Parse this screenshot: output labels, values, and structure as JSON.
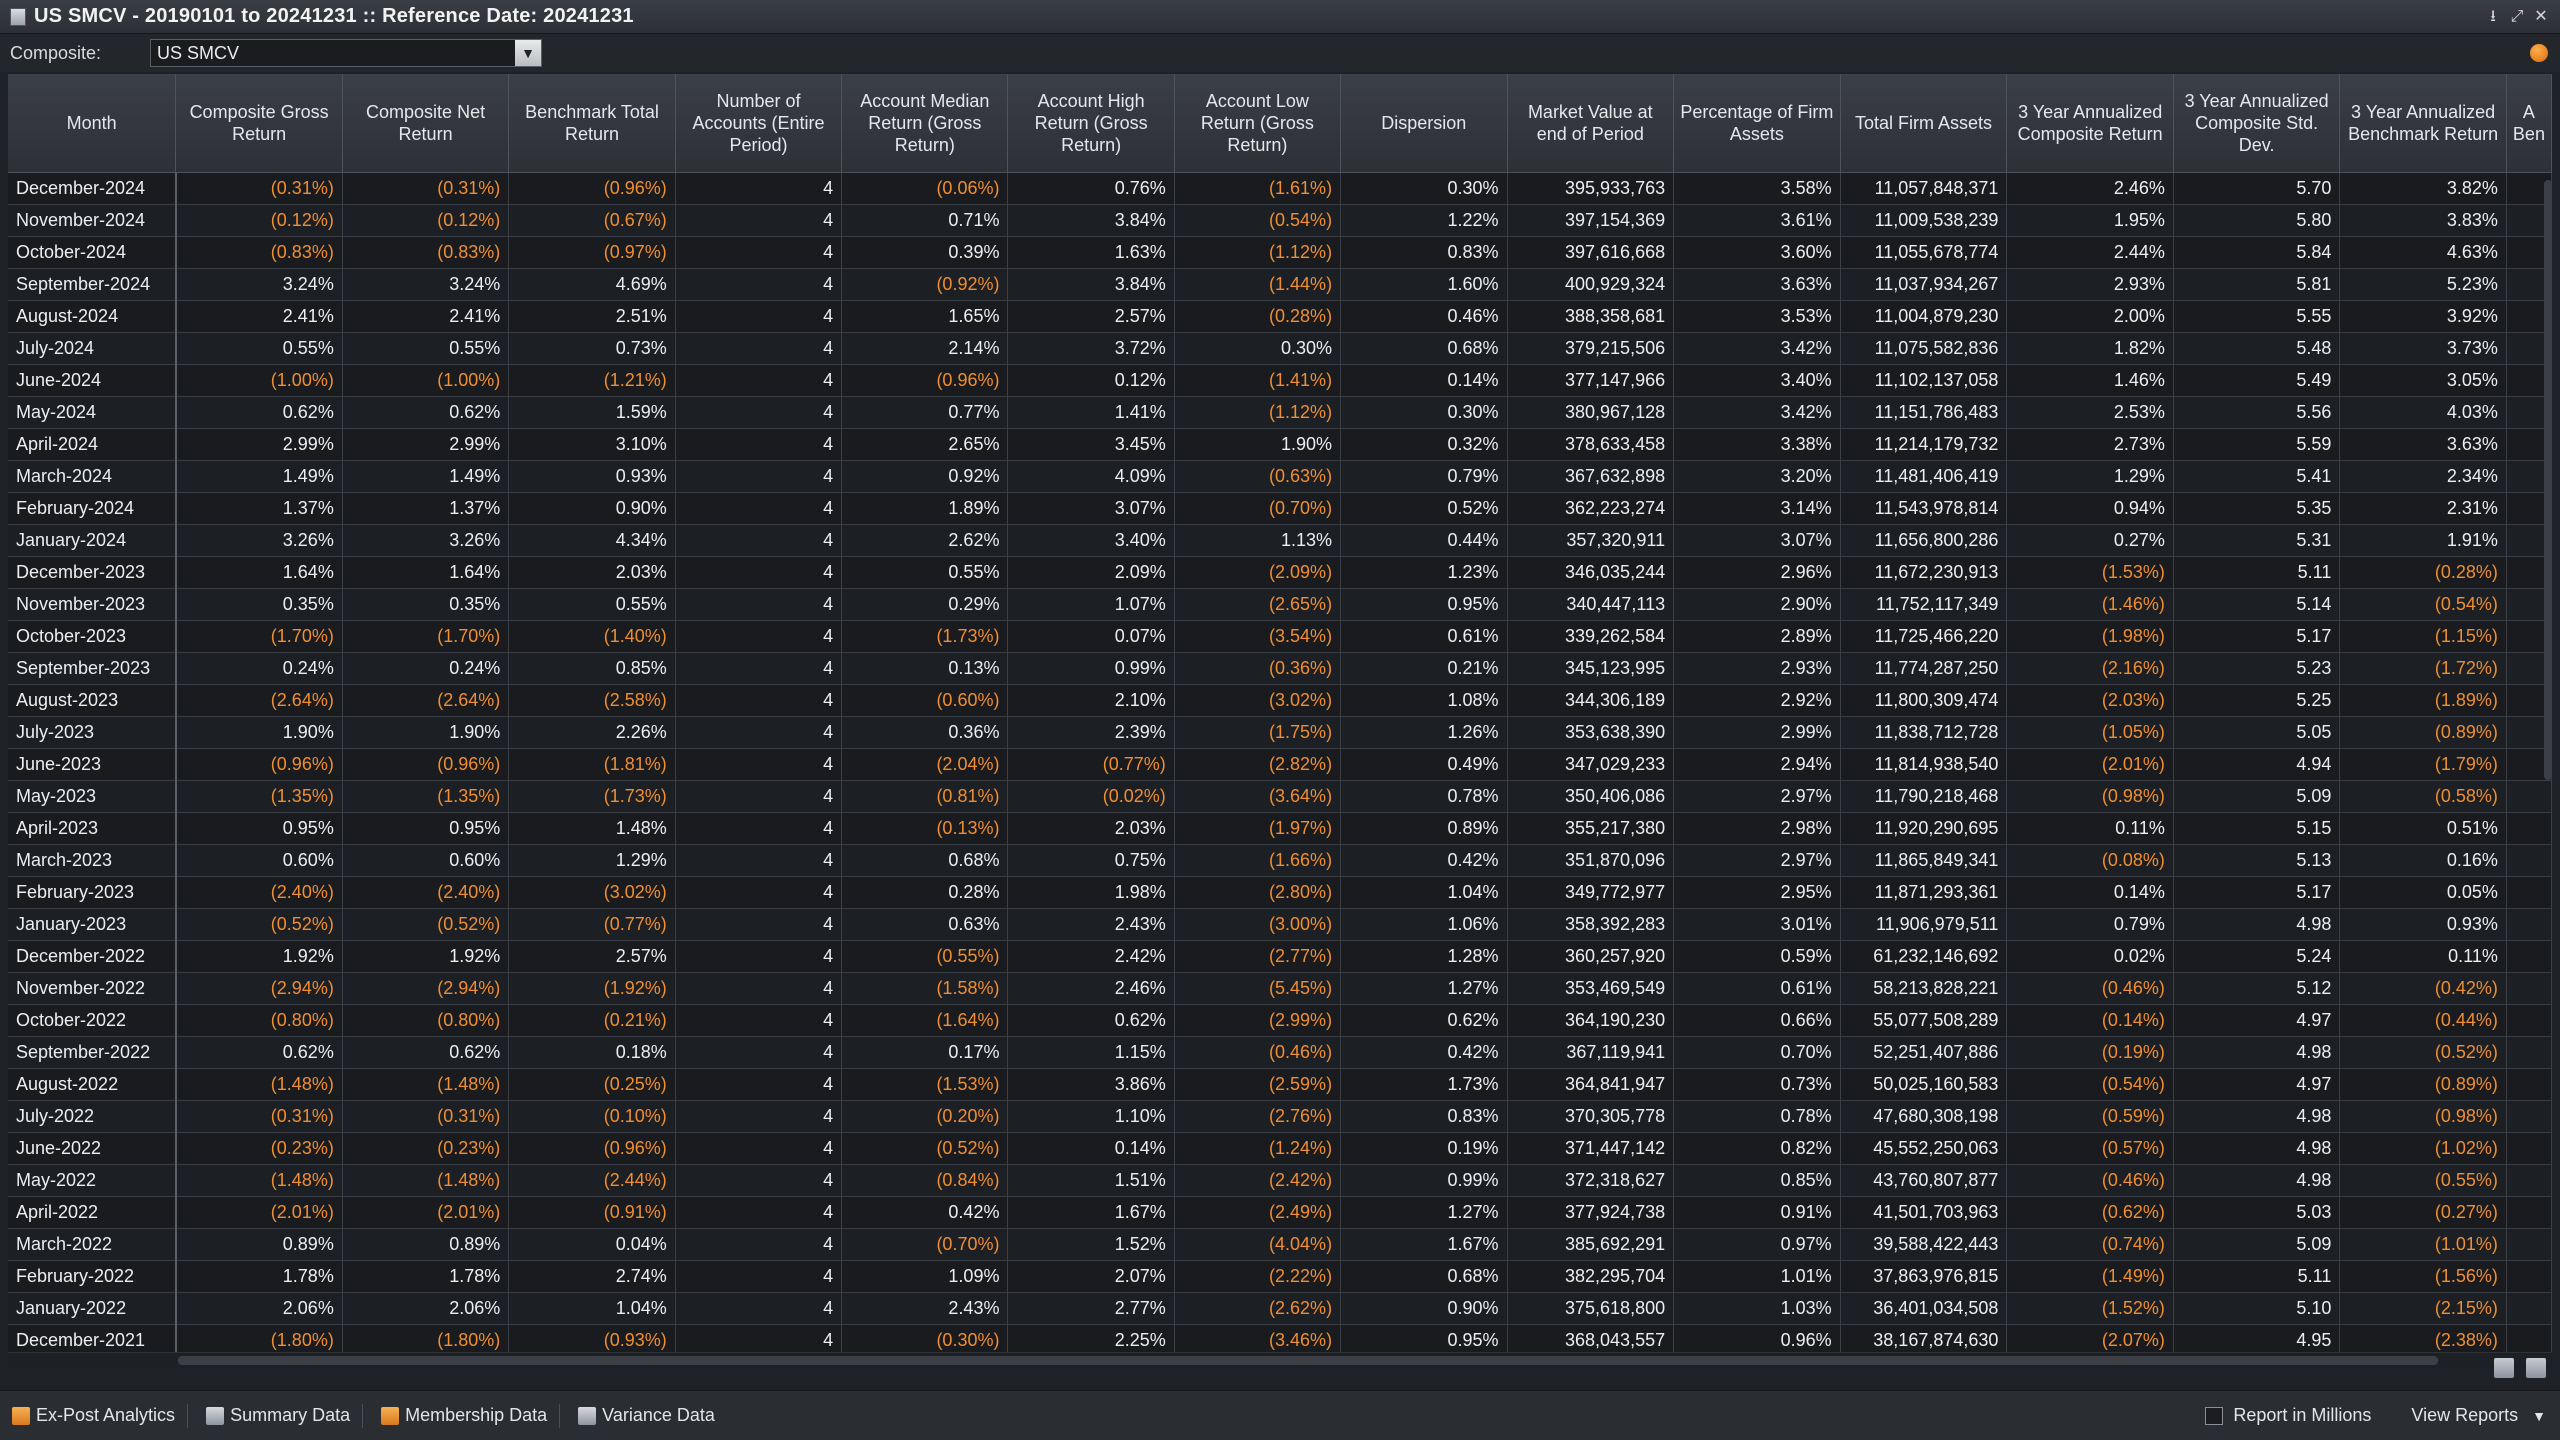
{
  "window": {
    "title": "US SMCV - 20190101 to 20241231 :: Reference Date: 20241231",
    "controls": [
      "⭳",
      "⤢",
      "✕"
    ]
  },
  "filter": {
    "label": "Composite:",
    "value": "US SMCV"
  },
  "columns": [
    {
      "key": "month",
      "label": "Month"
    },
    {
      "key": "cgr",
      "label": "Composite Gross Return"
    },
    {
      "key": "cnr",
      "label": "Composite Net Return"
    },
    {
      "key": "btr",
      "label": "Benchmark Total Return"
    },
    {
      "key": "num",
      "label": "Number of Accounts (Entire Period)"
    },
    {
      "key": "amed",
      "label": "Account Median Return (Gross Return)"
    },
    {
      "key": "ahigh",
      "label": "Account High Return (Gross Return)"
    },
    {
      "key": "alow",
      "label": "Account Low Return (Gross Return)"
    },
    {
      "key": "disp",
      "label": "Dispersion"
    },
    {
      "key": "mv",
      "label": "Market Value at end of Period"
    },
    {
      "key": "pct",
      "label": "Percentage of Firm Assets"
    },
    {
      "key": "tfa",
      "label": "Total Firm Assets"
    },
    {
      "key": "y3c",
      "label": "3 Year Annualized Composite Return"
    },
    {
      "key": "y3s",
      "label": "3 Year Annualized Composite Std. Dev."
    },
    {
      "key": "y3b",
      "label": "3 Year Annualized Benchmark Return"
    },
    {
      "key": "extra",
      "label": "A Ben"
    }
  ],
  "rows": [
    [
      "December-2024",
      "(0.31%)",
      "(0.31%)",
      "(0.96%)",
      "4",
      "(0.06%)",
      "0.76%",
      "(1.61%)",
      "0.30%",
      "395,933,763",
      "3.58%",
      "11,057,848,371",
      "2.46%",
      "5.70",
      "3.82%",
      ""
    ],
    [
      "November-2024",
      "(0.12%)",
      "(0.12%)",
      "(0.67%)",
      "4",
      "0.71%",
      "3.84%",
      "(0.54%)",
      "1.22%",
      "397,154,369",
      "3.61%",
      "11,009,538,239",
      "1.95%",
      "5.80",
      "3.83%",
      ""
    ],
    [
      "October-2024",
      "(0.83%)",
      "(0.83%)",
      "(0.97%)",
      "4",
      "0.39%",
      "1.63%",
      "(1.12%)",
      "0.83%",
      "397,616,668",
      "3.60%",
      "11,055,678,774",
      "2.44%",
      "5.84",
      "4.63%",
      ""
    ],
    [
      "September-2024",
      "3.24%",
      "3.24%",
      "4.69%",
      "4",
      "(0.92%)",
      "3.84%",
      "(1.44%)",
      "1.60%",
      "400,929,324",
      "3.63%",
      "11,037,934,267",
      "2.93%",
      "5.81",
      "5.23%",
      ""
    ],
    [
      "August-2024",
      "2.41%",
      "2.41%",
      "2.51%",
      "4",
      "1.65%",
      "2.57%",
      "(0.28%)",
      "0.46%",
      "388,358,681",
      "3.53%",
      "11,004,879,230",
      "2.00%",
      "5.55",
      "3.92%",
      ""
    ],
    [
      "July-2024",
      "0.55%",
      "0.55%",
      "0.73%",
      "4",
      "2.14%",
      "3.72%",
      "0.30%",
      "0.68%",
      "379,215,506",
      "3.42%",
      "11,075,582,836",
      "1.82%",
      "5.48",
      "3.73%",
      ""
    ],
    [
      "June-2024",
      "(1.00%)",
      "(1.00%)",
      "(1.21%)",
      "4",
      "(0.96%)",
      "0.12%",
      "(1.41%)",
      "0.14%",
      "377,147,966",
      "3.40%",
      "11,102,137,058",
      "1.46%",
      "5.49",
      "3.05%",
      ""
    ],
    [
      "May-2024",
      "0.62%",
      "0.62%",
      "1.59%",
      "4",
      "0.77%",
      "1.41%",
      "(1.12%)",
      "0.30%",
      "380,967,128",
      "3.42%",
      "11,151,786,483",
      "2.53%",
      "5.56",
      "4.03%",
      ""
    ],
    [
      "April-2024",
      "2.99%",
      "2.99%",
      "3.10%",
      "4",
      "2.65%",
      "3.45%",
      "1.90%",
      "0.32%",
      "378,633,458",
      "3.38%",
      "11,214,179,732",
      "2.73%",
      "5.59",
      "3.63%",
      ""
    ],
    [
      "March-2024",
      "1.49%",
      "1.49%",
      "0.93%",
      "4",
      "0.92%",
      "4.09%",
      "(0.63%)",
      "0.79%",
      "367,632,898",
      "3.20%",
      "11,481,406,419",
      "1.29%",
      "5.41",
      "2.34%",
      ""
    ],
    [
      "February-2024",
      "1.37%",
      "1.37%",
      "0.90%",
      "4",
      "1.89%",
      "3.07%",
      "(0.70%)",
      "0.52%",
      "362,223,274",
      "3.14%",
      "11,543,978,814",
      "0.94%",
      "5.35",
      "2.31%",
      ""
    ],
    [
      "January-2024",
      "3.26%",
      "3.26%",
      "4.34%",
      "4",
      "2.62%",
      "3.40%",
      "1.13%",
      "0.44%",
      "357,320,911",
      "3.07%",
      "11,656,800,286",
      "0.27%",
      "5.31",
      "1.91%",
      ""
    ],
    [
      "December-2023",
      "1.64%",
      "1.64%",
      "2.03%",
      "4",
      "0.55%",
      "2.09%",
      "(2.09%)",
      "1.23%",
      "346,035,244",
      "2.96%",
      "11,672,230,913",
      "(1.53%)",
      "5.11",
      "(0.28%)",
      ""
    ],
    [
      "November-2023",
      "0.35%",
      "0.35%",
      "0.55%",
      "4",
      "0.29%",
      "1.07%",
      "(2.65%)",
      "0.95%",
      "340,447,113",
      "2.90%",
      "11,752,117,349",
      "(1.46%)",
      "5.14",
      "(0.54%)",
      ""
    ],
    [
      "October-2023",
      "(1.70%)",
      "(1.70%)",
      "(1.40%)",
      "4",
      "(1.73%)",
      "0.07%",
      "(3.54%)",
      "0.61%",
      "339,262,584",
      "2.89%",
      "11,725,466,220",
      "(1.98%)",
      "5.17",
      "(1.15%)",
      ""
    ],
    [
      "September-2023",
      "0.24%",
      "0.24%",
      "0.85%",
      "4",
      "0.13%",
      "0.99%",
      "(0.36%)",
      "0.21%",
      "345,123,995",
      "2.93%",
      "11,774,287,250",
      "(2.16%)",
      "5.23",
      "(1.72%)",
      ""
    ],
    [
      "August-2023",
      "(2.64%)",
      "(2.64%)",
      "(2.58%)",
      "4",
      "(0.60%)",
      "2.10%",
      "(3.02%)",
      "1.08%",
      "344,306,189",
      "2.92%",
      "11,800,309,474",
      "(2.03%)",
      "5.25",
      "(1.89%)",
      ""
    ],
    [
      "July-2023",
      "1.90%",
      "1.90%",
      "2.26%",
      "4",
      "0.36%",
      "2.39%",
      "(1.75%)",
      "1.26%",
      "353,638,390",
      "2.99%",
      "11,838,712,728",
      "(1.05%)",
      "5.05",
      "(0.89%)",
      ""
    ],
    [
      "June-2023",
      "(0.96%)",
      "(0.96%)",
      "(1.81%)",
      "4",
      "(2.04%)",
      "(0.77%)",
      "(2.82%)",
      "0.49%",
      "347,029,233",
      "2.94%",
      "11,814,938,540",
      "(2.01%)",
      "4.94",
      "(1.79%)",
      ""
    ],
    [
      "May-2023",
      "(1.35%)",
      "(1.35%)",
      "(1.73%)",
      "4",
      "(0.81%)",
      "(0.02%)",
      "(3.64%)",
      "0.78%",
      "350,406,086",
      "2.97%",
      "11,790,218,468",
      "(0.98%)",
      "5.09",
      "(0.58%)",
      ""
    ],
    [
      "April-2023",
      "0.95%",
      "0.95%",
      "1.48%",
      "4",
      "(0.13%)",
      "2.03%",
      "(1.97%)",
      "0.89%",
      "355,217,380",
      "2.98%",
      "11,920,290,695",
      "0.11%",
      "5.15",
      "0.51%",
      ""
    ],
    [
      "March-2023",
      "0.60%",
      "0.60%",
      "1.29%",
      "4",
      "0.68%",
      "0.75%",
      "(1.66%)",
      "0.42%",
      "351,870,096",
      "2.97%",
      "11,865,849,341",
      "(0.08%)",
      "5.13",
      "0.16%",
      ""
    ],
    [
      "February-2023",
      "(2.40%)",
      "(2.40%)",
      "(3.02%)",
      "4",
      "0.28%",
      "1.98%",
      "(2.80%)",
      "1.04%",
      "349,772,977",
      "2.95%",
      "11,871,293,361",
      "0.14%",
      "5.17",
      "0.05%",
      ""
    ],
    [
      "January-2023",
      "(0.52%)",
      "(0.52%)",
      "(0.77%)",
      "4",
      "0.63%",
      "2.43%",
      "(3.00%)",
      "1.06%",
      "358,392,283",
      "3.01%",
      "11,906,979,511",
      "0.79%",
      "4.98",
      "0.93%",
      ""
    ],
    [
      "December-2022",
      "1.92%",
      "1.92%",
      "2.57%",
      "4",
      "(0.55%)",
      "2.42%",
      "(2.77%)",
      "1.28%",
      "360,257,920",
      "0.59%",
      "61,232,146,692",
      "0.02%",
      "5.24",
      "0.11%",
      ""
    ],
    [
      "November-2022",
      "(2.94%)",
      "(2.94%)",
      "(1.92%)",
      "4",
      "(1.58%)",
      "2.46%",
      "(5.45%)",
      "1.27%",
      "353,469,549",
      "0.61%",
      "58,213,828,221",
      "(0.46%)",
      "5.12",
      "(0.42%)",
      ""
    ],
    [
      "October-2022",
      "(0.80%)",
      "(0.80%)",
      "(0.21%)",
      "4",
      "(1.64%)",
      "0.62%",
      "(2.99%)",
      "0.62%",
      "364,190,230",
      "0.66%",
      "55,077,508,289",
      "(0.14%)",
      "4.97",
      "(0.44%)",
      ""
    ],
    [
      "September-2022",
      "0.62%",
      "0.62%",
      "0.18%",
      "4",
      "0.17%",
      "1.15%",
      "(0.46%)",
      "0.42%",
      "367,119,941",
      "0.70%",
      "52,251,407,886",
      "(0.19%)",
      "4.98",
      "(0.52%)",
      ""
    ],
    [
      "August-2022",
      "(1.48%)",
      "(1.48%)",
      "(0.25%)",
      "4",
      "(1.53%)",
      "3.86%",
      "(2.59%)",
      "1.73%",
      "364,841,947",
      "0.73%",
      "50,025,160,583",
      "(0.54%)",
      "4.97",
      "(0.89%)",
      ""
    ],
    [
      "July-2022",
      "(0.31%)",
      "(0.31%)",
      "(0.10%)",
      "4",
      "(0.20%)",
      "1.10%",
      "(2.76%)",
      "0.83%",
      "370,305,778",
      "0.78%",
      "47,680,308,198",
      "(0.59%)",
      "4.98",
      "(0.98%)",
      ""
    ],
    [
      "June-2022",
      "(0.23%)",
      "(0.23%)",
      "(0.96%)",
      "4",
      "(0.52%)",
      "0.14%",
      "(1.24%)",
      "0.19%",
      "371,447,142",
      "0.82%",
      "45,552,250,063",
      "(0.57%)",
      "4.98",
      "(1.02%)",
      ""
    ],
    [
      "May-2022",
      "(1.48%)",
      "(1.48%)",
      "(2.44%)",
      "4",
      "(0.84%)",
      "1.51%",
      "(2.42%)",
      "0.99%",
      "372,318,627",
      "0.85%",
      "43,760,807,877",
      "(0.46%)",
      "4.98",
      "(0.55%)",
      ""
    ],
    [
      "April-2022",
      "(2.01%)",
      "(2.01%)",
      "(0.91%)",
      "4",
      "0.42%",
      "1.67%",
      "(2.49%)",
      "1.27%",
      "377,924,738",
      "0.91%",
      "41,501,703,963",
      "(0.62%)",
      "5.03",
      "(0.27%)",
      ""
    ],
    [
      "March-2022",
      "0.89%",
      "0.89%",
      "0.04%",
      "4",
      "(0.70%)",
      "1.52%",
      "(4.04%)",
      "1.67%",
      "385,692,291",
      "0.97%",
      "39,588,422,443",
      "(0.74%)",
      "5.09",
      "(1.01%)",
      ""
    ],
    [
      "February-2022",
      "1.78%",
      "1.78%",
      "2.74%",
      "4",
      "1.09%",
      "2.07%",
      "(2.22%)",
      "0.68%",
      "382,295,704",
      "1.01%",
      "37,863,976,815",
      "(1.49%)",
      "5.11",
      "(1.56%)",
      ""
    ],
    [
      "January-2022",
      "2.06%",
      "2.06%",
      "1.04%",
      "4",
      "2.43%",
      "2.77%",
      "(2.62%)",
      "0.90%",
      "375,618,800",
      "1.03%",
      "36,401,034,508",
      "(1.52%)",
      "5.10",
      "(2.15%)",
      ""
    ],
    [
      "December-2021",
      "(1.80%)",
      "(1.80%)",
      "(0.93%)",
      "4",
      "(0.30%)",
      "2.25%",
      "(3.46%)",
      "0.95%",
      "368,043,557",
      "0.96%",
      "38,167,874,630",
      "(2.07%)",
      "4.95",
      "(2.38%)",
      ""
    ]
  ],
  "bottom": {
    "tabs": [
      "Ex-Post Analytics",
      "Summary Data",
      "Membership Data",
      "Variance Data"
    ],
    "report_in_millions": "Report in Millions",
    "view_reports": "View Reports"
  },
  "colors": {
    "negative": "#ef8e32",
    "accent": "#f08c1e"
  }
}
